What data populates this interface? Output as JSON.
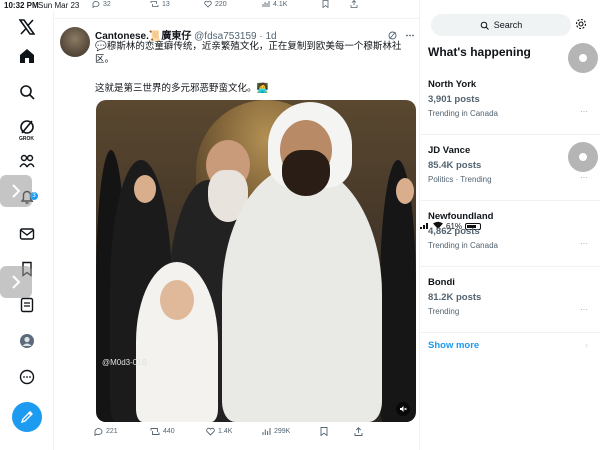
{
  "status_bar": {
    "time": "10:32 PM",
    "date": "Sun Mar 23",
    "battery": "61%"
  },
  "top_counts": {
    "replies": "32",
    "retweets": "13",
    "likes": "220",
    "views": "4.1K"
  },
  "tweet": {
    "author_name": "Cantonese.📜廣東仔",
    "handle": "@fdsa753159",
    "age": "· 1d",
    "text_line1": "💬穆斯林的恋童癖传统，近亲繁殖文化，正在复制到欧美每一个穆斯林社区。",
    "text_line2": "这就是第三世界的多元邪恶野蛮文化。🧑‍💻",
    "media_watermark": "@M0d3-01B",
    "replies": "221",
    "retweets": "440",
    "likes": "1.4K",
    "views": "299K"
  },
  "nav": {
    "grok_label": "GROK",
    "notification_count": "3"
  },
  "search": {
    "placeholder": "Search"
  },
  "happening": {
    "title": "What's happening",
    "trends": [
      {
        "name": "North York",
        "count": "3,901 posts",
        "context": "Trending in Canada"
      },
      {
        "name": "JD Vance",
        "count": "85.4K posts",
        "context": "Politics · Trending"
      },
      {
        "name": "Newfoundland",
        "count": "4,862 posts",
        "context": "Trending in Canada"
      },
      {
        "name": "Bondi",
        "count": "81.2K posts",
        "context": "Trending"
      }
    ],
    "show_more": "Show more"
  },
  "colors": {
    "accent": "#1d9bf0",
    "text": "#0f1419",
    "muted": "#536471"
  }
}
